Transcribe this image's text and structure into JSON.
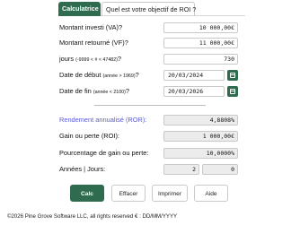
{
  "tabs": [
    {
      "label": "Calculatrice"
    },
    {
      "label": "Quel est votre objectif de ROI ?"
    }
  ],
  "form": {
    "montant_investi": {
      "label": "Montant investi (VA)?",
      "value": "10 000,00€"
    },
    "montant_retourne": {
      "label": "Montant retourné (VF)?",
      "value": "11 000,00€"
    },
    "jours": {
      "label": "jours",
      "hint": "(-9999 < # < 47482)",
      "suffix": "?",
      "value": "730"
    },
    "date_debut": {
      "label": "Date de début",
      "hint": "(année > 1969)",
      "suffix": "?",
      "value": "20/03/2024"
    },
    "date_fin": {
      "label": "Date de fin",
      "hint": "(année < 2100)",
      "suffix": "?",
      "value": "20/03/2026"
    }
  },
  "results": {
    "rendement": {
      "label": "Rendement annualisé (ROR):",
      "value": "4,8808%"
    },
    "gain": {
      "label": "Gain ou perte (ROI):",
      "value": "1 000,00€"
    },
    "pourcentage": {
      "label": "Pourcentage de gain ou perte:",
      "value": "10,0000%"
    },
    "annees_jours": {
      "label": "Années | Jours:",
      "years": "2",
      "days": "0"
    }
  },
  "buttons": {
    "calc": "Calc",
    "effacer": "Effacer",
    "imprimer": "Imprimer",
    "aide": "Aide"
  },
  "footer": "©2026 Pine Grove Software LLC, all rights reserved  € : DD/MM/YYYY",
  "colors": {
    "accent": "#2f6b4f",
    "rate_label": "#5b5bd6",
    "readonly_bg": "#ececec"
  },
  "icons": [
    "calendar-icon"
  ]
}
